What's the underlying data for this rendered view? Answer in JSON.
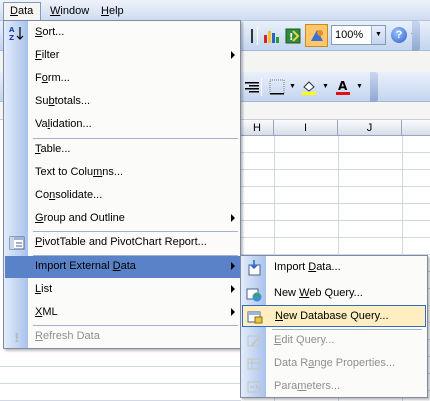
{
  "menubar": {
    "items": [
      {
        "label_pre": "",
        "label_key": "D",
        "label_post": "ata"
      },
      {
        "label_pre": "",
        "label_key": "W",
        "label_post": "indow"
      },
      {
        "label_pre": "",
        "label_key": "H",
        "label_post": "elp"
      }
    ]
  },
  "toolbar": {
    "zoom_value": "100%",
    "icons": [
      "insert-row-icon",
      "chart-wizard-icon",
      "refresh-data-icon",
      "drawing-icon",
      "help-icon",
      "borders-icon",
      "fill-color-icon",
      "font-color-icon",
      "align-right-icon"
    ]
  },
  "columns": [
    "H",
    "I",
    "J"
  ],
  "data_menu": {
    "items": [
      {
        "pre": "",
        "key": "S",
        "post": "ort...",
        "icon": "sort-icon"
      },
      {
        "pre": "",
        "key": "F",
        "post": "ilter",
        "submenu": true
      },
      {
        "pre": "F",
        "key": "o",
        "post": "rm..."
      },
      {
        "pre": "Su",
        "key": "b",
        "post": "totals..."
      },
      {
        "pre": "Va",
        "key": "l",
        "post": "idation..."
      },
      {
        "pre": "",
        "key": "T",
        "post": "able..."
      },
      {
        "pre": "Text to Colu",
        "key": "m",
        "post": "ns..."
      },
      {
        "pre": "Co",
        "key": "n",
        "post": "solidate..."
      },
      {
        "pre": "",
        "key": "G",
        "post": "roup and Outline",
        "submenu": true
      },
      {
        "pre": "",
        "key": "P",
        "post": "ivotTable and PivotChart Report...",
        "icon": "pivottable-icon"
      },
      {
        "pre": "Import External ",
        "key": "D",
        "post": "ata",
        "submenu": true
      },
      {
        "pre": "",
        "key": "L",
        "post": "ist",
        "submenu": true
      },
      {
        "pre": "",
        "key": "X",
        "post": "ML",
        "submenu": true
      },
      {
        "pre": "",
        "key": "R",
        "post": "efresh Data",
        "icon": "refresh-data-icon",
        "disabled": true
      }
    ]
  },
  "import_submenu": {
    "items": [
      {
        "pre": "Import ",
        "key": "D",
        "post": "ata...",
        "icon": "import-data-icon"
      },
      {
        "pre": "New ",
        "key": "W",
        "post": "eb Query...",
        "icon": "new-web-query-icon"
      },
      {
        "pre": "",
        "key": "N",
        "post": "ew Database Query...",
        "icon": "new-database-query-icon"
      },
      {
        "pre": "",
        "key": "E",
        "post": "dit Query...",
        "icon": "edit-query-icon",
        "disabled": true
      },
      {
        "pre": "Data R",
        "key": "a",
        "post": "nge Properties...",
        "icon": "data-range-properties-icon",
        "disabled": true
      },
      {
        "pre": "Para",
        "key": "m",
        "post": "eters...",
        "icon": "parameters-icon",
        "disabled": true
      }
    ]
  }
}
